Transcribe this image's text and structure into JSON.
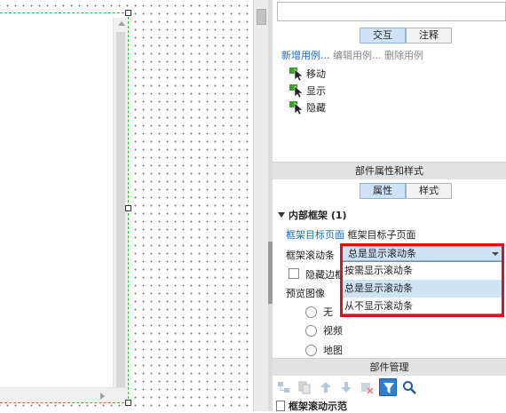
{
  "interaction_panel": {
    "search_value": "",
    "tabs": [
      "交互",
      "注释"
    ],
    "active_tab": "交互",
    "actions": {
      "new_case": "新增用例...",
      "edit_case": "编辑用例...",
      "delete_case": "删除用例"
    },
    "cases": [
      "移动",
      "显示",
      "隐藏"
    ]
  },
  "widget_properties": {
    "header": "部件属性和样式",
    "tabs": [
      "属性",
      "样式"
    ],
    "active_tab": "属性",
    "group_title": "内部框架 (1)",
    "target_links": {
      "target_page": "框架目标页面",
      "target_child_page": "框架目标子页面"
    },
    "scroll_label": "框架滚动条",
    "scroll_selected": "总是显示滚动条",
    "scroll_options": [
      "按需显示滚动条",
      "总是显示滚动条",
      "从不显示滚动条"
    ],
    "hide_border_label": "隐藏边框",
    "hide_border_checked": false,
    "preview_label": "预览图像",
    "preview_options": [
      "无",
      "视频",
      "地图"
    ]
  },
  "widget_manager": {
    "header": "部件管理",
    "tree_items": [
      "框架滚动示范"
    ]
  },
  "colors": {
    "highlight": "#d7141a",
    "selection": "#cfe3f7",
    "link": "#1c6bb5",
    "guide": "#2fbf2f"
  }
}
